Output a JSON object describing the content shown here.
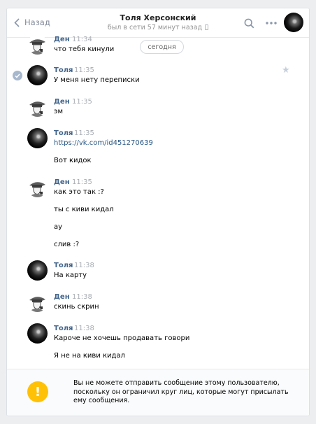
{
  "header": {
    "back_label": "Назад",
    "title": "Толя Херсонский",
    "status": "был в сети 57 минут назад",
    "icons": [
      "back-icon",
      "search-icon",
      "more-icon",
      "phone-icon"
    ]
  },
  "date_separator": "сегодня",
  "messages": [
    {
      "author": "Ден",
      "time": "11:34",
      "lines": [
        "что тебя кинули"
      ]
    },
    {
      "author": "Толя",
      "time": "11:35",
      "lines": [
        "У меня нету переписки"
      ],
      "selected": true
    },
    {
      "author": "Ден",
      "time": "11:35",
      "lines": [
        "эм"
      ]
    },
    {
      "author": "Толя",
      "time": "11:35",
      "lines": [
        "https://vk.com/id451270639",
        "Вот кидок"
      ]
    },
    {
      "author": "Ден",
      "time": "11:35",
      "lines": [
        "как это так :?",
        "ты с киви кидал",
        "ау",
        "слив :?"
      ]
    },
    {
      "author": "Толя",
      "time": "11:38",
      "lines": [
        "На карту"
      ]
    },
    {
      "author": "Ден",
      "time": "11:38",
      "lines": [
        "скинь скрин"
      ]
    },
    {
      "author": "Толя",
      "time": "11:38",
      "lines": [
        "Кароче не хочешь продавать говори",
        "Я не на киви кидал"
      ]
    }
  ],
  "footer": {
    "icon": "exclamation-icon",
    "notice": "Вы не можете отправить сообщение этому пользователю,\nпоскольку он ограничил круг лиц, которые могут присылать\nему сообщения."
  },
  "colors": {
    "author": "#42648b",
    "link": "#2a5885",
    "warning": "#ffc107"
  }
}
